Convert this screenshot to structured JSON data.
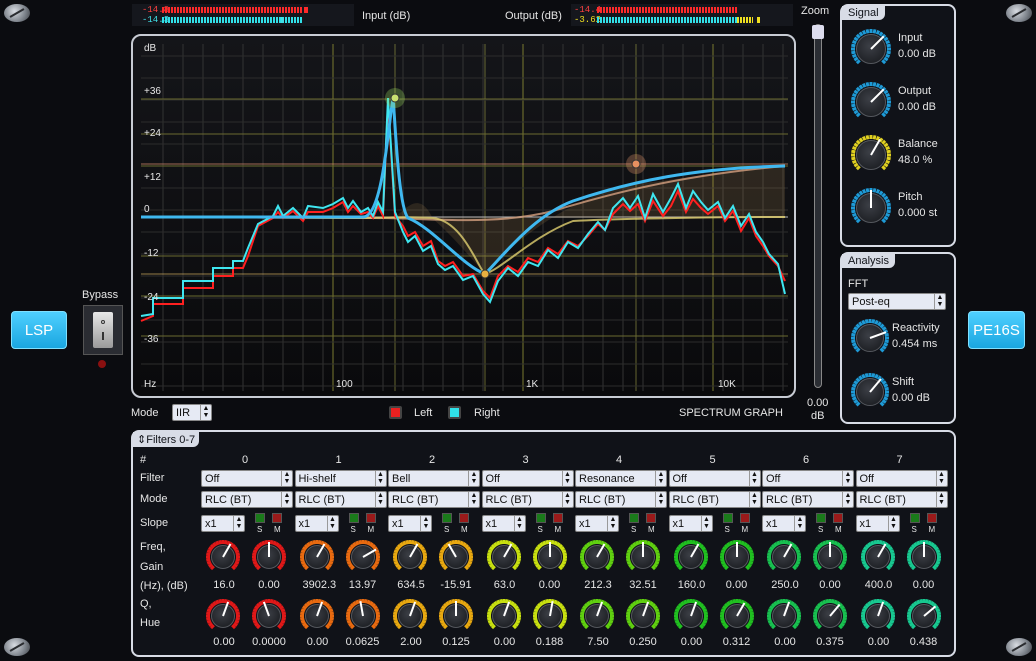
{
  "meters": {
    "input_label": "Input (dB)",
    "output_label": "Output (dB)",
    "input_left": "-14.8",
    "input_right": "-14.3",
    "output_left": "-14.4",
    "output_right": "-3.62"
  },
  "side": {
    "left_button": "LSP",
    "right_button": "PE16S"
  },
  "bypass_label": "Bypass",
  "zoom": {
    "label": "Zoom",
    "value": "0.00",
    "unit": "dB"
  },
  "graph": {
    "y_unit": "dB",
    "x_unit": "Hz",
    "y_ticks": [
      "+36",
      "+24",
      "+12",
      "0",
      "-12",
      "-24",
      "-36"
    ],
    "x_ticks": [
      "100",
      "1K",
      "10K"
    ],
    "title": "SPECTRUM GRAPH"
  },
  "below_graph": {
    "mode_label": "Mode",
    "mode_value": "IIR",
    "left_label": "Left",
    "right_label": "Right"
  },
  "signal": {
    "title": "Signal",
    "knobs": [
      {
        "label": "Input",
        "value": "0.00 dB",
        "color": "#1e9ad6"
      },
      {
        "label": "Output",
        "value": "0.00 dB",
        "color": "#1e9ad6"
      },
      {
        "label": "Balance",
        "value": "48.0 %",
        "color": "#e0d020"
      },
      {
        "label": "Pitch",
        "value": "0.000 st",
        "color": "#1e9ad6"
      }
    ]
  },
  "analysis": {
    "title": "Analysis",
    "fft_label": "FFT",
    "fft_value": "Post-eq",
    "knobs": [
      {
        "label": "Reactivity",
        "value": "0.454 ms",
        "color": "#1e9ad6"
      },
      {
        "label": "Shift",
        "value": "0.00 dB",
        "color": "#1e9ad6"
      }
    ]
  },
  "filters": {
    "title": "Filters 0-7",
    "row_labels": {
      "num": "#",
      "filter": "Filter",
      "mode": "Mode",
      "slope": "Slope",
      "freq": "Freq,",
      "gain": "Gain",
      "units": "(Hz), (dB)",
      "q": "Q,",
      "hue": "Hue",
      "s": "S",
      "m": "M"
    },
    "columns": [
      {
        "index": "0",
        "type": "Off",
        "mode": "RLC (BT)",
        "slope": "x1",
        "freq": "16.0",
        "gain": "0.00",
        "q": "0.00",
        "hue": "0.0000",
        "color": "#e01818"
      },
      {
        "index": "1",
        "type": "Hi-shelf",
        "mode": "RLC (BT)",
        "slope": "x1",
        "freq": "3902.3",
        "gain": "13.97",
        "q": "0.00",
        "hue": "0.0625",
        "color": "#e86a10"
      },
      {
        "index": "2",
        "type": "Bell",
        "mode": "RLC (BT)",
        "slope": "x1",
        "freq": "634.5",
        "gain": "-15.91",
        "q": "2.00",
        "hue": "0.125",
        "color": "#e8a810"
      },
      {
        "index": "3",
        "type": "Off",
        "mode": "RLC (BT)",
        "slope": "x1",
        "freq": "63.0",
        "gain": "0.00",
        "q": "0.00",
        "hue": "0.188",
        "color": "#c8e010"
      },
      {
        "index": "4",
        "type": "Resonance",
        "mode": "RLC (BT)",
        "slope": "x1",
        "freq": "212.3",
        "gain": "32.51",
        "q": "7.50",
        "hue": "0.250",
        "color": "#60d010"
      },
      {
        "index": "5",
        "type": "Off",
        "mode": "RLC (BT)",
        "slope": "x1",
        "freq": "160.0",
        "gain": "0.00",
        "q": "0.00",
        "hue": "0.312",
        "color": "#20c020"
      },
      {
        "index": "6",
        "type": "Off",
        "mode": "RLC (BT)",
        "slope": "x1",
        "freq": "250.0",
        "gain": "0.00",
        "q": "0.00",
        "hue": "0.375",
        "color": "#18c050"
      },
      {
        "index": "7",
        "type": "Off",
        "mode": "RLC (BT)",
        "slope": "x1",
        "freq": "400.0",
        "gain": "0.00",
        "q": "0.00",
        "hue": "0.438",
        "color": "#18c890"
      }
    ]
  }
}
